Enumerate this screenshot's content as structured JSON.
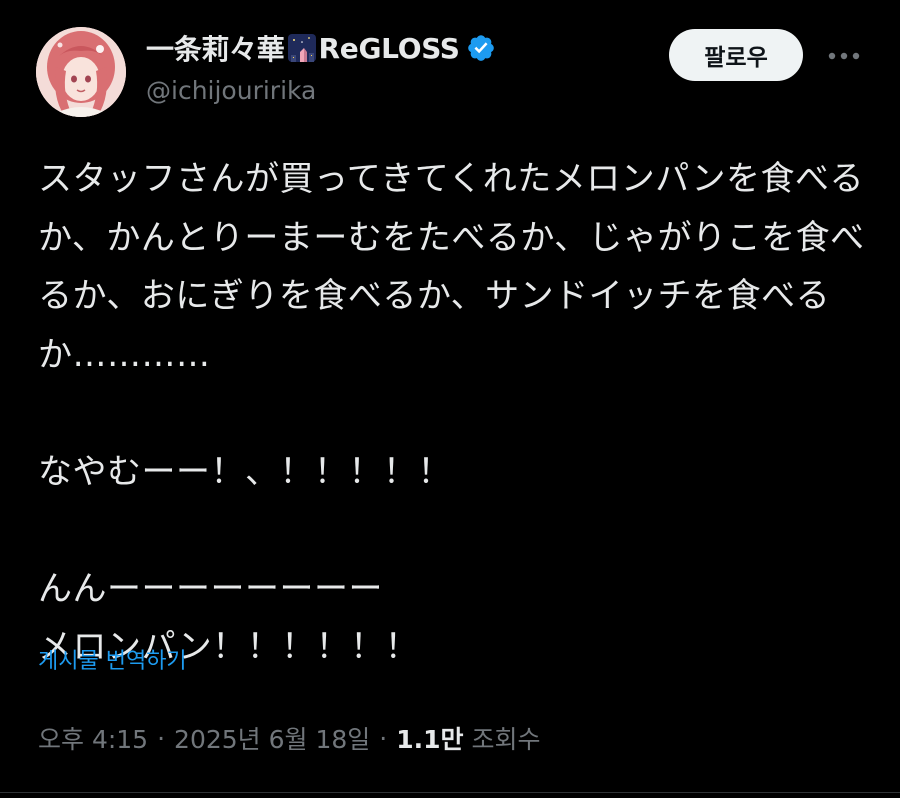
{
  "author": {
    "display_name": "一条莉々華",
    "group_suffix": "ReGLOSS",
    "handle": "@ichijouririka",
    "badge_icon": "night-city-emoji-icon",
    "verified_icon": "verified-badge-icon",
    "verified_color": "#1d9bf0"
  },
  "actions": {
    "follow_label": "팔로우",
    "more_icon": "more-horizontal-icon"
  },
  "tweet": {
    "text": "スタッフさんが買ってきてくれたメロンパンを食べるか、かんとりーまーむをたべるか、じゃがりこを食べるか、おにぎりを食べるか、サンドイッチを食べるか…………\n\nなやむーー！、！！！！！\n\nんんーーーーーーーー\nメロンパン！！！！！！",
    "translate_label": "게시물 번역하기"
  },
  "meta": {
    "time": "오후 4:15",
    "date": "2025년 6월 18일",
    "views_count": "1.1만",
    "views_label": "조회수",
    "separator": "·"
  },
  "colors": {
    "background": "#000000",
    "text_primary": "#e7e9ea",
    "text_secondary": "#71767b",
    "link": "#1d9bf0",
    "follow_bg": "#eff3f4"
  }
}
